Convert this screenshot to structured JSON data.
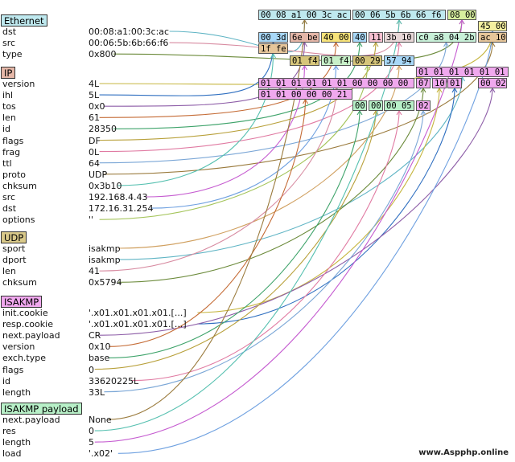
{
  "layers": [
    {
      "name": "Ethernet",
      "color": "#bfe9ef",
      "fields": [
        {
          "name": "dst",
          "value": "00:08:a1:00:3c:ac"
        },
        {
          "name": "src",
          "value": "00:06:5b:6b:66:f6"
        },
        {
          "name": "type",
          "value": "0x800"
        }
      ]
    },
    {
      "name": "IP",
      "color": "#e5b7a8",
      "fields": [
        {
          "name": "version",
          "value": "4L"
        },
        {
          "name": "ihl",
          "value": "5L"
        },
        {
          "name": "tos",
          "value": "0x0"
        },
        {
          "name": "len",
          "value": "61"
        },
        {
          "name": "id",
          "value": "28350"
        },
        {
          "name": "flags",
          "value": "DF"
        },
        {
          "name": "frag",
          "value": "0L"
        },
        {
          "name": "ttl",
          "value": "64"
        },
        {
          "name": "proto",
          "value": "UDP"
        },
        {
          "name": "chksum",
          "value": "0x3b10"
        },
        {
          "name": "src",
          "value": "192.168.4.43"
        },
        {
          "name": "dst",
          "value": "172.16.31.254"
        },
        {
          "name": "options",
          "value": "''"
        }
      ]
    },
    {
      "name": "UDP",
      "color": "#d9c98a",
      "fields": [
        {
          "name": "sport",
          "value": "isakmp"
        },
        {
          "name": "dport",
          "value": "isakmp"
        },
        {
          "name": "len",
          "value": "41"
        },
        {
          "name": "chksum",
          "value": "0x5794"
        }
      ]
    },
    {
      "name": "ISAKMP",
      "color": "#f0a8ee",
      "fields": [
        {
          "name": "init_cookie",
          "value": "'.x01.x01.x01.x01.[...]"
        },
        {
          "name": "resp_cookie",
          "value": "'.x01.x01.x01.x01.[...]"
        },
        {
          "name": "next_payload",
          "value": "CR"
        },
        {
          "name": "version",
          "value": "0x10"
        },
        {
          "name": "exch_type",
          "value": "base"
        },
        {
          "name": "flags",
          "value": "0"
        },
        {
          "name": "id",
          "value": "33620225L"
        },
        {
          "name": "length",
          "value": "33L"
        }
      ]
    },
    {
      "name": "ISAKMP payload",
      "color": "#b8f0c8",
      "fields": [
        {
          "name": "next_payload",
          "value": "None"
        },
        {
          "name": "res",
          "value": "0"
        },
        {
          "name": "length",
          "value": "5"
        },
        {
          "name": "load",
          "value": "'.x02'"
        }
      ]
    }
  ],
  "field_labels": {
    "init_cookie": "init_cookie",
    "resp_cookie": "resp_cookie",
    "next_payload": "next_payload",
    "exch_type": "exch_type"
  },
  "hex_boxes": [
    {
      "text": "00 08 a1 00 3c ac",
      "color": "#bfe9ef"
    },
    {
      "text": "00 06 5b 6b 66 f6",
      "color": "#bfe9ef"
    },
    {
      "text": "08 00",
      "color": "#d6ee9e"
    },
    {
      "text": "45 00",
      "color": "#f5f0a0"
    },
    {
      "text": "00 3d",
      "color": "#a8d8f8"
    },
    {
      "text": "6e be",
      "color": "#e5b7a8"
    },
    {
      "text": "40 00",
      "color": "#f7e37a"
    },
    {
      "text": "40",
      "color": "#a8d8f8"
    },
    {
      "text": "11",
      "color": "#f6c0d0"
    },
    {
      "text": "3b 10",
      "color": "#e8d8d8"
    },
    {
      "text": "c0 a8 04 2b",
      "color": "#c8f0d8"
    },
    {
      "text": "ac 10",
      "color": "#e6c69a"
    },
    {
      "text": "1f fe",
      "color": "#e6c69a"
    },
    {
      "text": "01 f4",
      "color": "#d6c57a"
    },
    {
      "text": "01 f4",
      "color": "#c8f0c8"
    },
    {
      "text": "00 29",
      "color": "#d6c57a"
    },
    {
      "text": "57 94",
      "color": "#a8d8f8"
    },
    {
      "text": "01 01 01 01 01 01",
      "color": "#f0a8ee"
    },
    {
      "text": "01 01 01 01 01 01 00 00 00 00",
      "color": "#f0a8ee"
    },
    {
      "text": "07",
      "color": "#f0a8ee"
    },
    {
      "text": "10",
      "color": "#f0a8ee"
    },
    {
      "text": "01",
      "color": "#f0a8ee"
    },
    {
      "text": "00 02 01",
      "color": "#f0a8ee"
    },
    {
      "text": "01 01 00 00 00 21",
      "color": "#f0a8ee"
    },
    {
      "text": "00",
      "color": "#b8f0c8"
    },
    {
      "text": "00",
      "color": "#b8f0c8"
    },
    {
      "text": "00 05",
      "color": "#b8f0c8"
    },
    {
      "text": "02",
      "color": "#f0a8ee"
    }
  ],
  "watermark": "www.Aspphp.online"
}
